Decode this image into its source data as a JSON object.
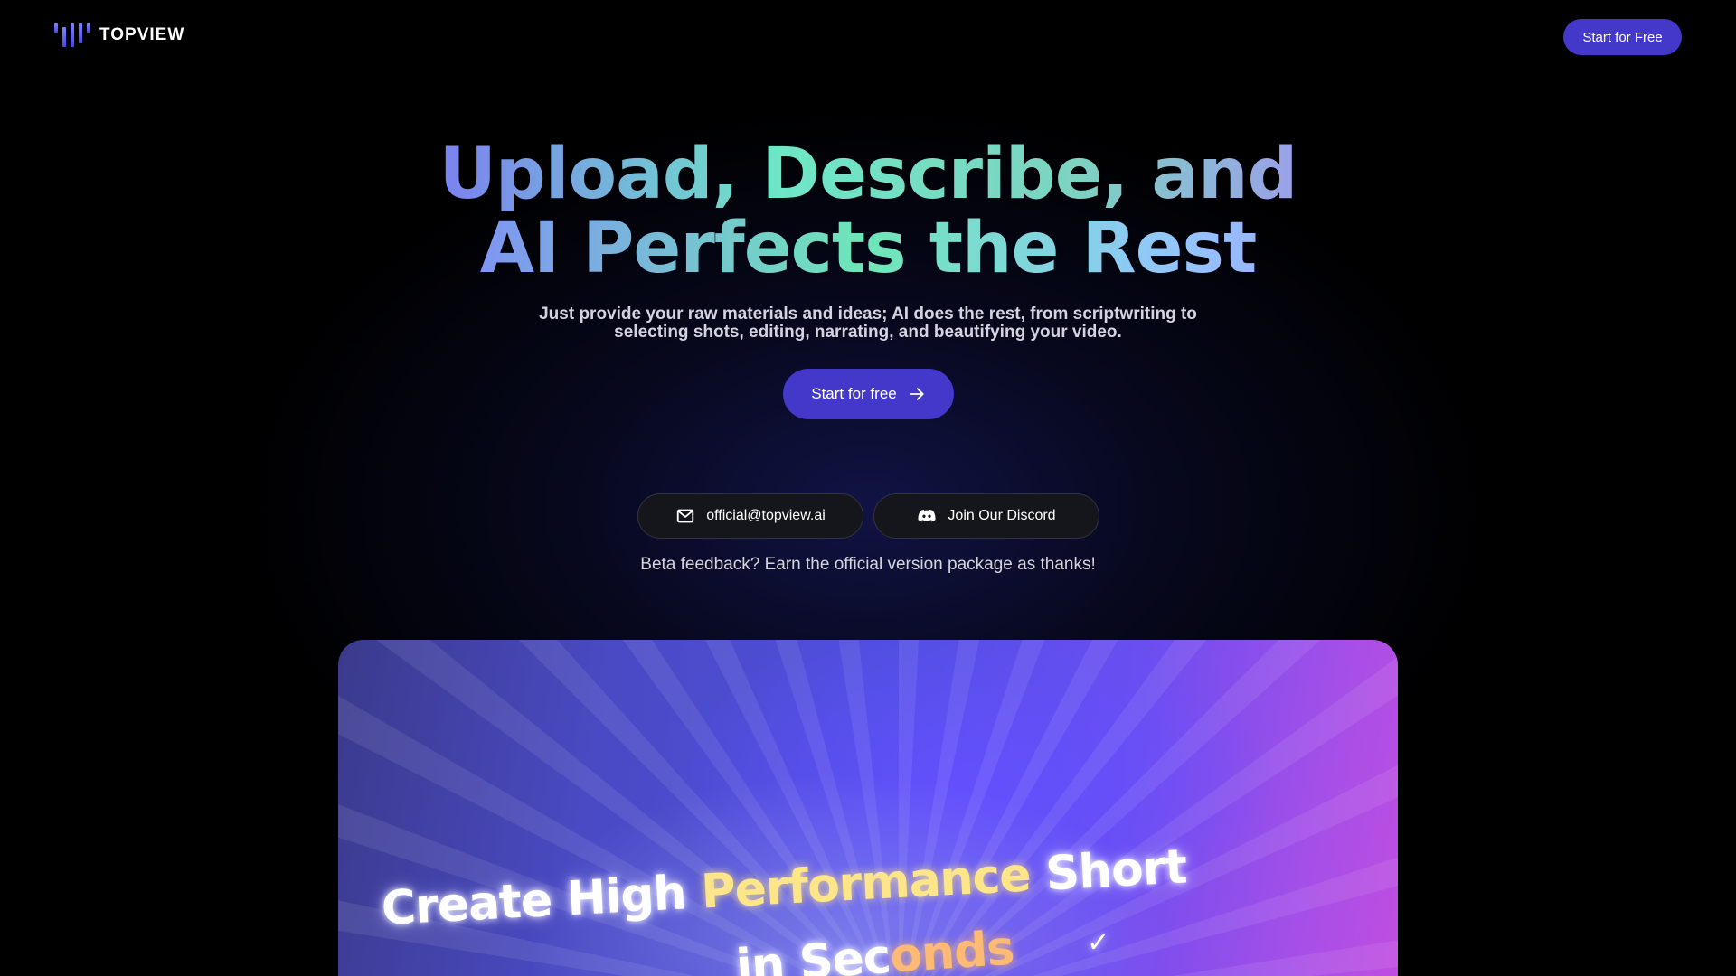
{
  "brand": {
    "name": "TOPVIEW"
  },
  "nav": {
    "cta_label": "Start for Free"
  },
  "hero": {
    "title_line1": "Upload, Describe, and",
    "title_line2": "AI Perfects the Rest",
    "subtitle": "Just provide your raw materials and ideas; AI does the rest, from scriptwriting to selecting shots, editing, narrating, and beautifying your video.",
    "cta_label": "Start for free"
  },
  "contact": {
    "email_label": "official@topview.ai",
    "discord_label": "Join Our Discord",
    "feedback_text": "Beta feedback? Earn the official version package as thanks!"
  },
  "video_preview": {
    "line1_a": "Create High ",
    "line1_b": "Performance",
    "line1_c": " Short",
    "line2_a": "in Sec",
    "line2_b": "onds",
    "check_glyph": "✓"
  },
  "icons": {
    "logo": "topview-logo-icon",
    "arrow": "arrow-right-icon",
    "mail": "mail-icon",
    "discord": "discord-icon"
  },
  "colors": {
    "accent": "#4338ca",
    "background": "#000000",
    "pill_bg": "#15151c"
  }
}
